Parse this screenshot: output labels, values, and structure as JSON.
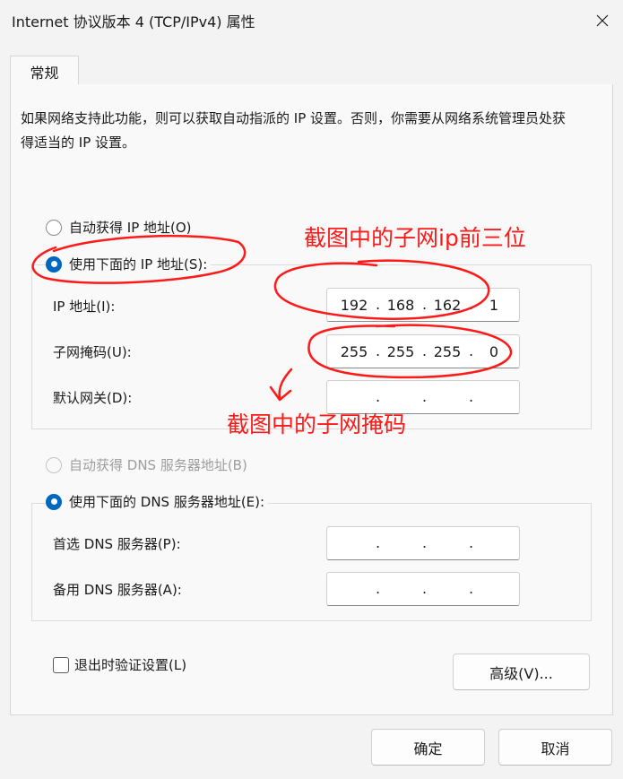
{
  "window": {
    "title": "Internet 协议版本 4 (TCP/IPv4) 属性",
    "close_icon": "close-icon"
  },
  "tabs": [
    {
      "label": "常规",
      "selected": true
    }
  ],
  "description": "如果网络支持此功能，则可以获取自动指派的 IP 设置。否则，你需要从网络系统管理员处获得适当的 IP 设置。",
  "ip_section": {
    "auto_label": "自动获得 IP 地址(O)",
    "manual_label": "使用下面的 IP 地址(S):",
    "selected": "manual",
    "fields": [
      {
        "label": "IP 地址(I):",
        "octets": [
          "192",
          "168",
          "162",
          "1"
        ]
      },
      {
        "label": "子网掩码(U):",
        "octets": [
          "255",
          "255",
          "255",
          "0"
        ]
      },
      {
        "label": "默认网关(D):",
        "octets": [
          "",
          "",
          "",
          ""
        ]
      }
    ]
  },
  "dns_section": {
    "auto_label": "自动获得 DNS 服务器地址(B)",
    "auto_disabled": true,
    "manual_label": "使用下面的 DNS 服务器地址(E):",
    "selected": "manual",
    "fields": [
      {
        "label": "首选 DNS 服务器(P):",
        "octets": [
          "",
          "",
          "",
          ""
        ]
      },
      {
        "label": "备用 DNS 服务器(A):",
        "octets": [
          "",
          "",
          "",
          ""
        ]
      }
    ]
  },
  "validate_on_exit": {
    "label": "退出时验证设置(L)",
    "checked": false
  },
  "buttons": {
    "advanced": "高级(V)...",
    "ok": "确定",
    "cancel": "取消"
  },
  "annotations": {
    "subnet_prefix_note": "截图中的子网ip前三位",
    "subnet_mask_note": "截图中的子网掩码",
    "color": "#ff1a1a"
  },
  "colors": {
    "accent": "#0067c0",
    "background": "#f3f3f3",
    "panel": "#f9f9f9"
  }
}
